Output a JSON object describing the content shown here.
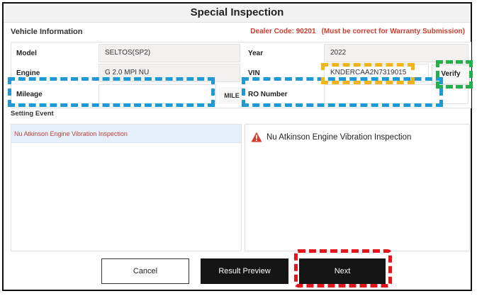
{
  "window": {
    "title": "Special Inspection"
  },
  "vehicle_info": {
    "heading": "Vehicle Information",
    "dealer_code": "Dealer Code: 90201",
    "dealer_note": "(Must be correct for Warranty Submission)",
    "model_label": "Model",
    "model_value": "SELTOS(SP2)",
    "year_label": "Year",
    "year_value": "2022",
    "engine_label": "Engine",
    "engine_value": "G 2.0 MPI NU",
    "vin_label": "VIN",
    "vin_value": "KNDERCAA2N7319015",
    "verify_label": "Verify",
    "mileage_label": "Mileage",
    "mileage_value": "",
    "mileage_unit": "MILE",
    "ro_label": "RO Number",
    "ro_value": ""
  },
  "setting_event": {
    "heading": "Setting Event",
    "items": [
      "Nu Atkinson Engine Vibration Inspection"
    ],
    "detail_text": "Nu Atkinson Engine Vibration Inspection"
  },
  "buttons": {
    "cancel": "Cancel",
    "preview": "Result Preview",
    "next": "Next"
  },
  "colors": {
    "accent_red": "#cc3d2e",
    "highlight_blue": "#1d9ad6",
    "highlight_yellow": "#f2b417",
    "highlight_green": "#22b04b",
    "highlight_red": "#e3141c"
  },
  "icons": {
    "warning": "warning-triangle-icon"
  }
}
